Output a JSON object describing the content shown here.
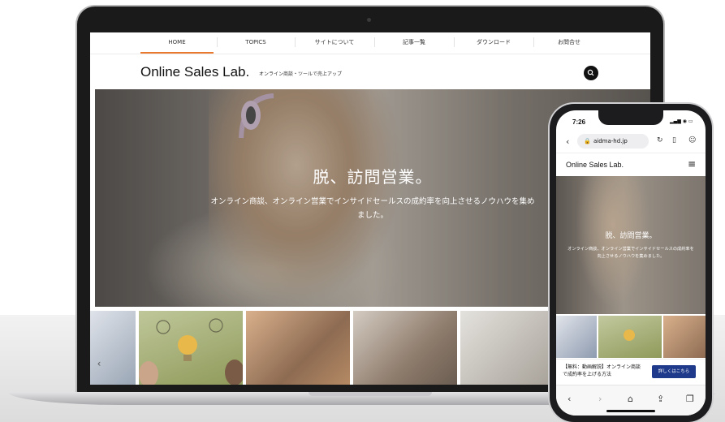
{
  "site": {
    "nav": [
      "HOME",
      "TOPICS",
      "サイトについて",
      "記事一覧",
      "ダウンロード",
      "お問合せ"
    ],
    "active_nav": "HOME",
    "logo": "Online Sales Lab.",
    "tagline": "オンライン商談・ツールで売上アップ",
    "hero_title": "脱、訪問営業。",
    "hero_subtitle": "オンライン商談、オンライン営業でインサイドセールスの成約率を向上させるノウハウを集めました。",
    "carousel_prev": "‹"
  },
  "mobile": {
    "time": "7:26",
    "url": "aidma-hd.jp",
    "logo": "Online Sales Lab.",
    "hero_title": "脱、訪問営業。",
    "hero_subtitle": "オンライン商談、オンライン営業でインサイドセールスの成約率を向上させるノウハウを集めました。",
    "banner_text": "【無料：動画解説】オンライン商談で成約率を上げる方法",
    "banner_button": "詳しくはこちら",
    "menu_icon": "hamburger-icon"
  },
  "colors": {
    "accent": "#e8792e",
    "banner_button": "#1f3a8a"
  }
}
